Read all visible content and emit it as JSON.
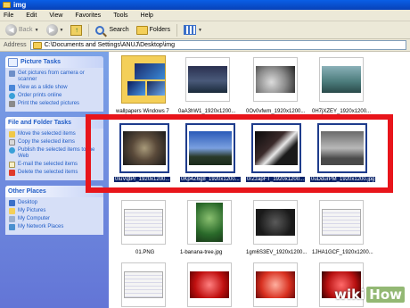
{
  "window": {
    "title": "img"
  },
  "menu": [
    "File",
    "Edit",
    "View",
    "Favorites",
    "Tools",
    "Help"
  ],
  "toolbar": {
    "back_label": "Back",
    "search_label": "Search",
    "folders_label": "Folders"
  },
  "address": {
    "label": "Address",
    "value": "C:\\Documents and Settings\\ANUJ\\Desktop\\img"
  },
  "picture_tasks": {
    "title": "Picture Tasks",
    "items": [
      "Get pictures from camera or scanner",
      "View as a slide show",
      "Order prints online",
      "Print the selected pictures"
    ]
  },
  "file_folder_tasks": {
    "title": "File and Folder Tasks",
    "items": [
      "Move the selected items",
      "Copy the selected items",
      "Publish the selected items to the Web",
      "E-mail the selected items",
      "Delete the selected items"
    ]
  },
  "other_places": {
    "title": "Other Places",
    "items": [
      "Desktop",
      "My Pictures",
      "My Computer",
      "My Network Places"
    ]
  },
  "files": {
    "row1": [
      "wallpapers Windows 7",
      "0aA3hW1_1920x1200...",
      "0Ov0vfwm_1920x1200...",
      "0H7jXZEY_1920x1200..."
    ],
    "row2": [
      "0IuVqtPr_1920x1200...",
      "0Kp4Z6g8_1920x1200...",
      "0rZzapFT_1920x1200...",
      "0uDdurPM_1920x1200.jpg"
    ],
    "row3": [
      "01.PNG",
      "1-banana-tree.jpg",
      "1gm6S3EV_1920x1200...",
      "1JHA1GCF_1920x1200..."
    ]
  },
  "watermark": {
    "wiki": "wiki",
    "how": "How"
  },
  "colors": {
    "highlight": "#e8151b",
    "selection": "#0a246a",
    "xp_blue": "#0841b8"
  }
}
